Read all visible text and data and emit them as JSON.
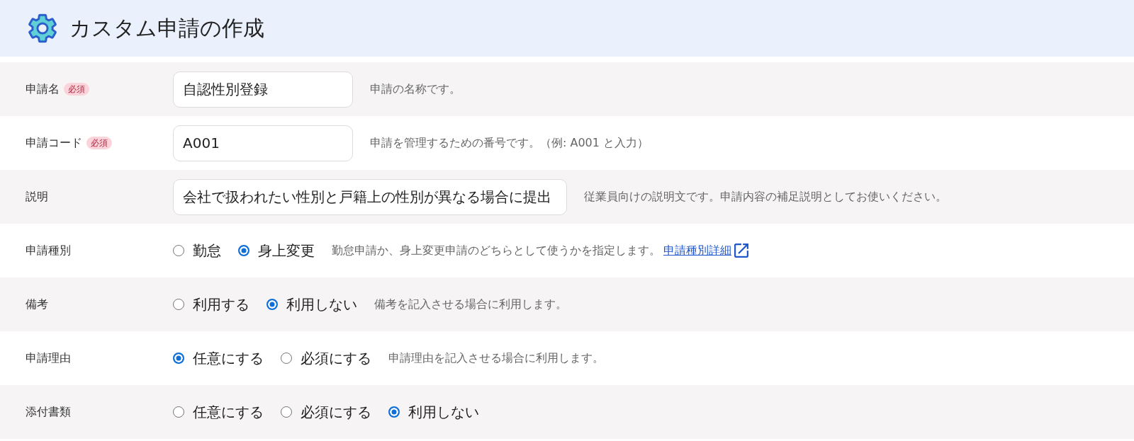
{
  "header": {
    "title": "カスタム申請の作成"
  },
  "fields": [
    {
      "kind": "text",
      "label": "申請名",
      "badge": "必須",
      "value": "自認性別登録",
      "hint": "申請の名称です。"
    },
    {
      "kind": "text",
      "label": "申請コード",
      "badge": "必須",
      "value": "A001",
      "hint": "申請を管理するための番号です。（例: A001 と入力）"
    },
    {
      "kind": "text",
      "label": "説明",
      "value": "会社で扱われたい性別と戸籍上の性別が異なる場合に提出",
      "hint": "従業員向けの説明文です。申請内容の補足説明としてお使いください。"
    },
    {
      "kind": "radio",
      "label": "申請種別",
      "options": [
        {
          "label": "勤怠",
          "selected": false
        },
        {
          "label": "身上変更",
          "selected": true
        }
      ],
      "hint": "勤怠申請か、身上変更申請のどちらとして使うかを指定します。",
      "link": "申請種別詳細"
    },
    {
      "kind": "radio",
      "label": "備考",
      "options": [
        {
          "label": "利用する",
          "selected": false
        },
        {
          "label": "利用しない",
          "selected": true
        }
      ],
      "hint": "備考を記入させる場合に利用します。"
    },
    {
      "kind": "radio",
      "label": "申請理由",
      "options": [
        {
          "label": "任意にする",
          "selected": true
        },
        {
          "label": "必須にする",
          "selected": false
        }
      ],
      "hint": "申請理由を記入させる場合に利用します。"
    },
    {
      "kind": "radio",
      "label": "添付書類",
      "options": [
        {
          "label": "任意にする",
          "selected": false
        },
        {
          "label": "必須にする",
          "selected": false
        },
        {
          "label": "利用しない",
          "selected": true
        }
      ]
    }
  ]
}
